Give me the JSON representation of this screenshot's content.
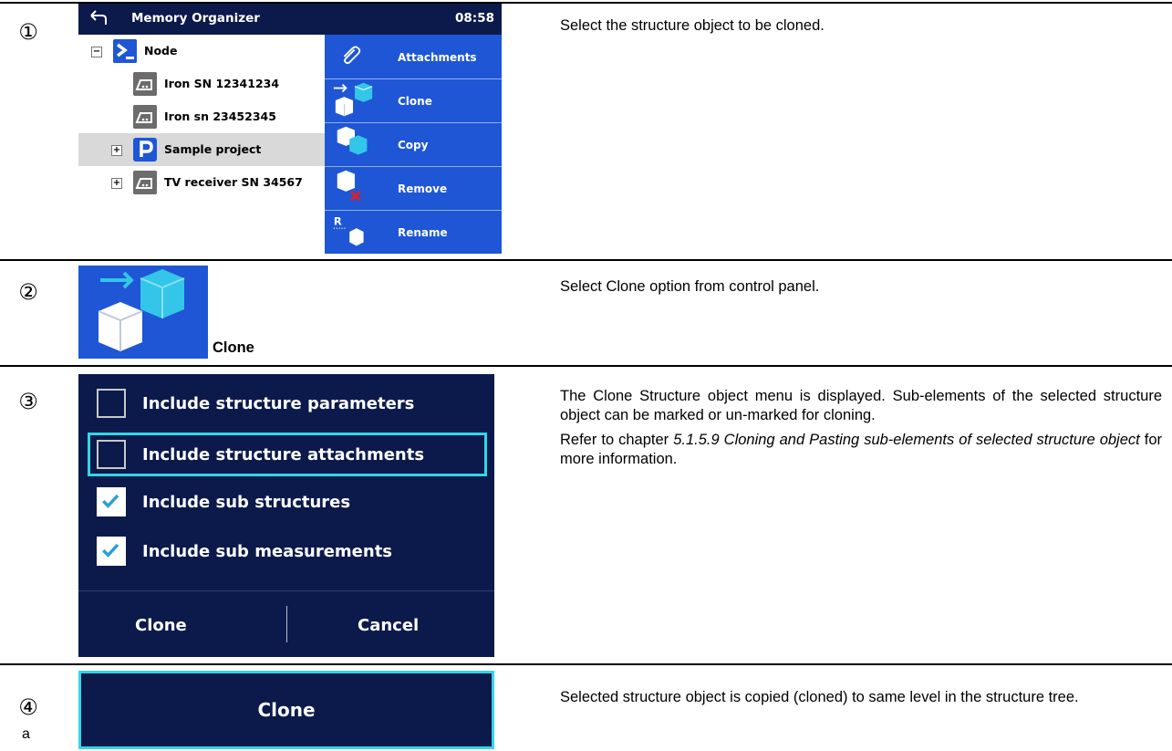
{
  "steps": [
    {
      "num": "①",
      "description": "Select the structure object to be cloned."
    },
    {
      "num": "②",
      "description": "Select Clone option from control panel.",
      "caption": "Clone"
    },
    {
      "num": "③",
      "description_p1": "The Clone Structure object menu is displayed. Sub-elements of the selected structure object can be marked or un-marked for cloning.",
      "description_p2_pre": "Refer to chapter ",
      "description_p2_ref": "5.1.5.9 Cloning and Pasting sub-elements of selected structure object",
      "description_p2_post": " for more information."
    },
    {
      "num": "④",
      "sub": "a",
      "description": "Selected structure object is copied (cloned) to same level in the structure tree."
    }
  ],
  "memory_organizer": {
    "title": "Memory Organizer",
    "time": "08:58",
    "tree": [
      {
        "label": "Node",
        "icon": "node-icon",
        "expander": "−"
      },
      {
        "label": "Iron SN 12341234",
        "icon": "iron-icon"
      },
      {
        "label": "Iron sn 23452345",
        "icon": "iron-icon"
      },
      {
        "label": "Sample project",
        "icon": "project-icon",
        "expander": "+",
        "selected": true
      },
      {
        "label": "TV receiver SN 34567",
        "icon": "iron-icon",
        "expander": "+"
      }
    ],
    "panel": [
      {
        "label": "Attachments",
        "icon": "paperclip-icon"
      },
      {
        "label": "Clone",
        "icon": "clone-icon"
      },
      {
        "label": "Copy",
        "icon": "copy-icon"
      },
      {
        "label": "Remove",
        "icon": "remove-icon"
      },
      {
        "label": "Rename",
        "icon": "rename-icon"
      }
    ]
  },
  "clone_menu": {
    "options": [
      {
        "label": "Include structure parameters",
        "checked": false
      },
      {
        "label": "Include structure attachments",
        "checked": false,
        "focused": true
      },
      {
        "label": "Include sub structures",
        "checked": true
      },
      {
        "label": "Include sub measurements",
        "checked": true
      }
    ],
    "clone_button": "Clone",
    "cancel_button": "Cancel"
  },
  "clone_confirm": {
    "label": "Clone"
  },
  "colors": {
    "dark_navy": "#0b1a4b",
    "panel_blue": "#1e56d6",
    "focus_cyan": "#33d6e6"
  }
}
